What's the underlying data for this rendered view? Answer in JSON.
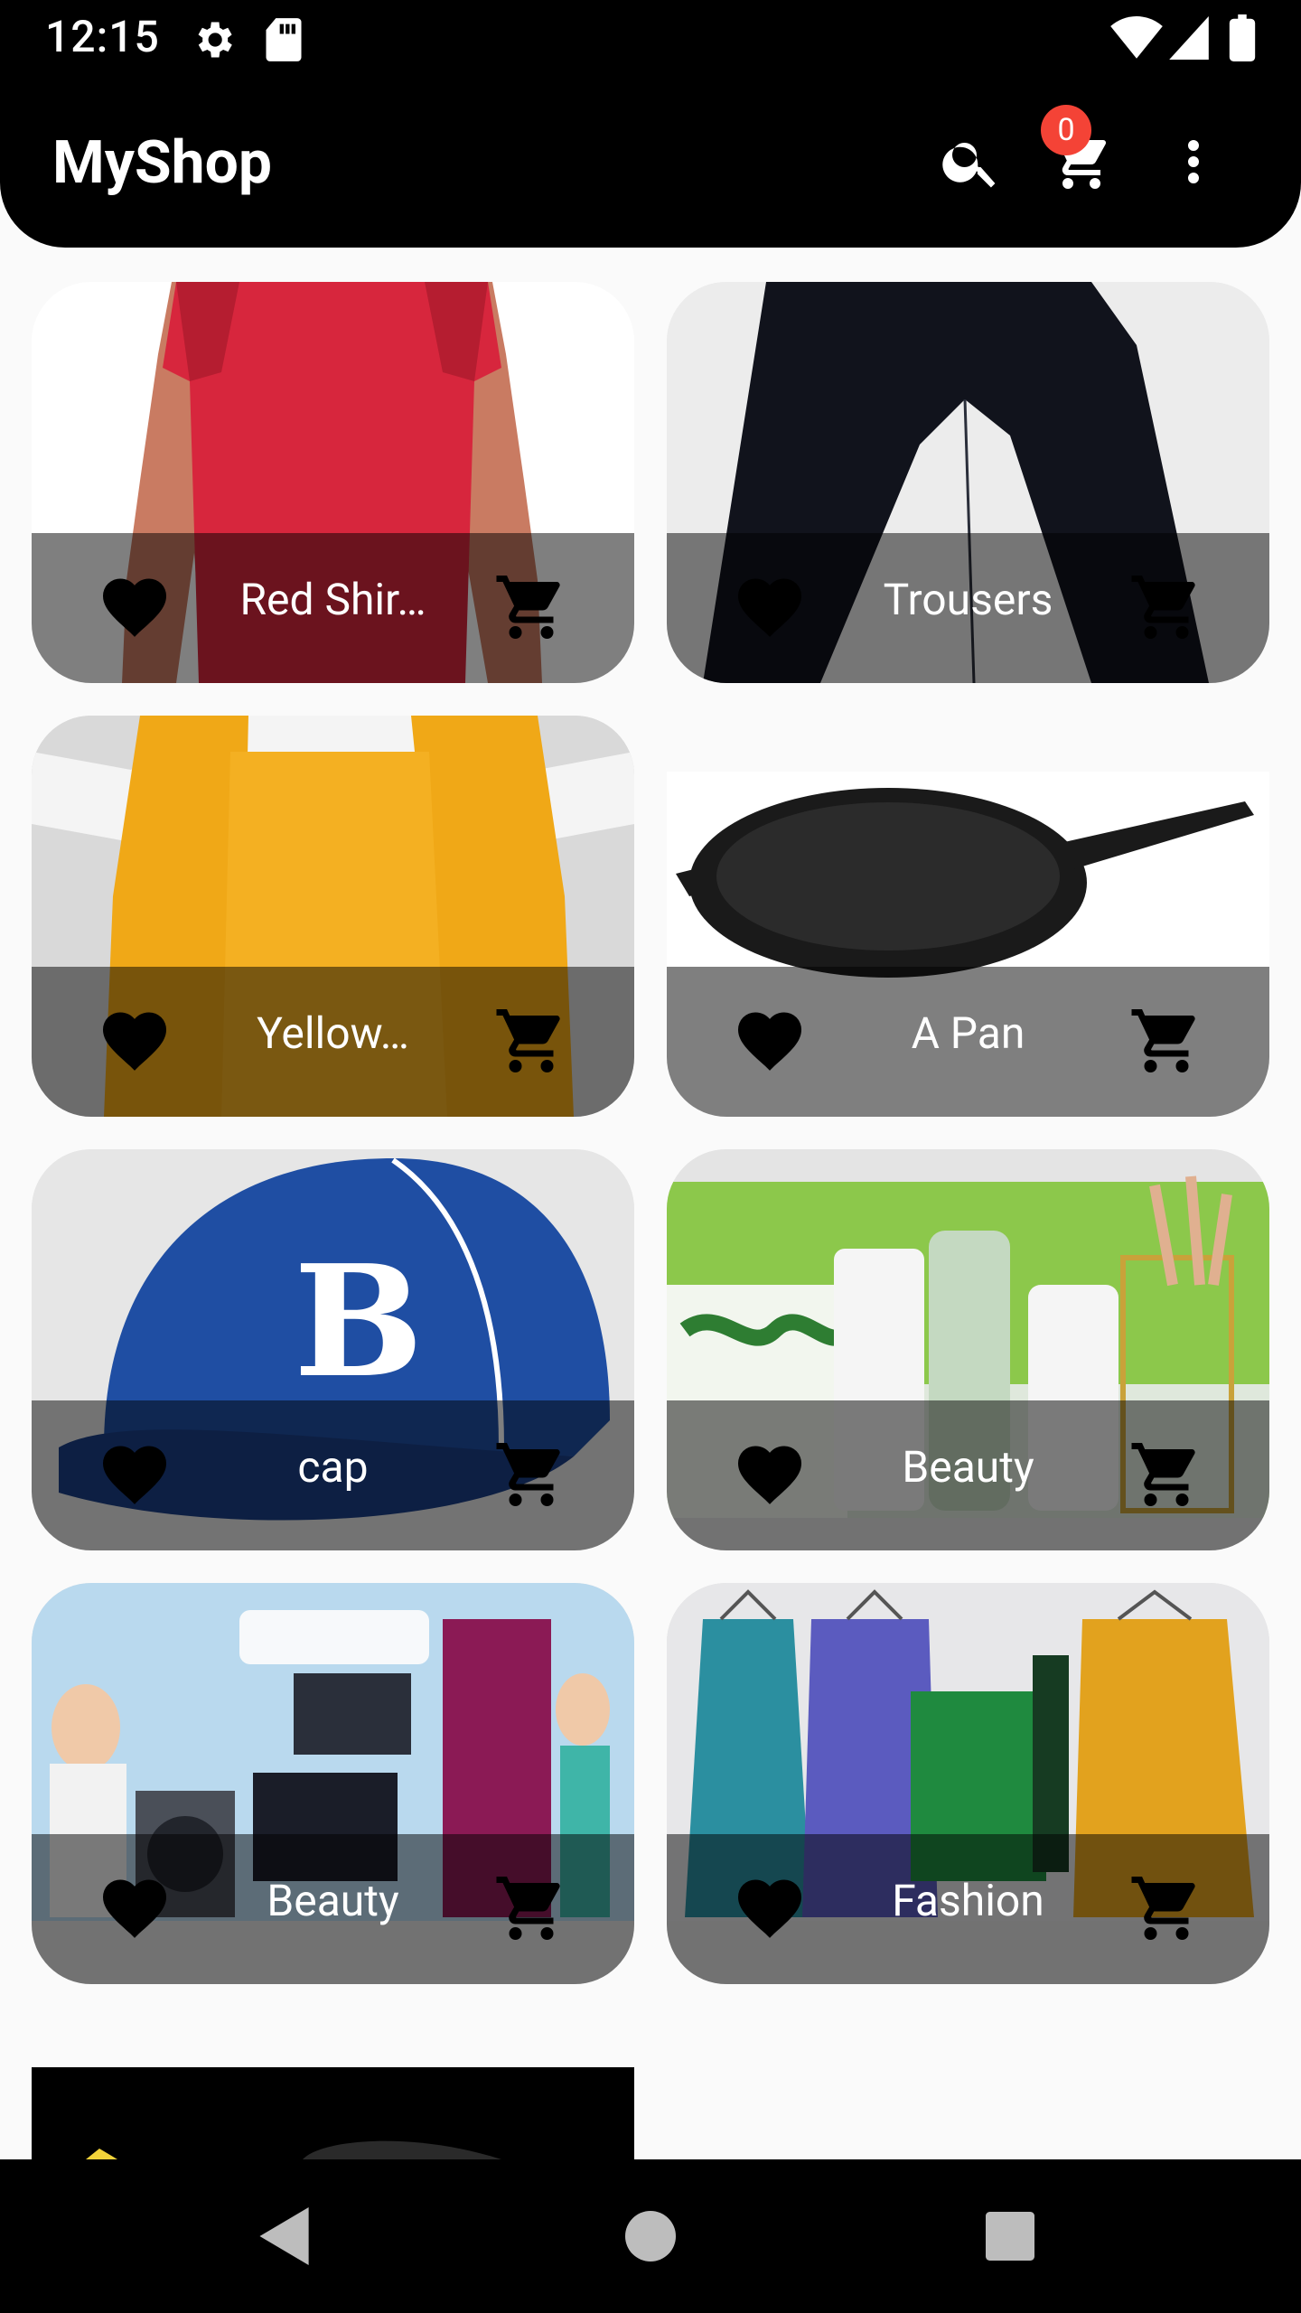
{
  "status_bar": {
    "time": "12:15",
    "icons": [
      "settings-icon",
      "sd-card-icon",
      "wifi-icon",
      "signal-icon",
      "battery-icon"
    ]
  },
  "app_bar": {
    "title": "MyShop",
    "cart_count": "0",
    "icons": [
      "search-icon",
      "cart-icon",
      "more-vert-icon"
    ]
  },
  "colors": {
    "app_bar": "#000000",
    "badge": "#f44336",
    "background": "#fafafa",
    "overlay": "rgba(0,0,0,0.5)"
  },
  "products": [
    {
      "title": "Red Shir…",
      "image": "red t-shirt on person"
    },
    {
      "title": "Trousers",
      "image": "black trousers"
    },
    {
      "title": "Yellow…",
      "image": "yellow knitted scarf"
    },
    {
      "title": "A Pan",
      "image": "black cast iron pan"
    },
    {
      "title": "cap",
      "image": "blue baseball cap"
    },
    {
      "title": "Beauty",
      "image": "skincare products"
    },
    {
      "title": "Beauty",
      "image": "home appliances"
    },
    {
      "title": "Fashion",
      "image": "jackets and dresses on hangers"
    }
  ],
  "nav_bar": {
    "icons": [
      "back-icon",
      "home-icon",
      "recents-icon"
    ]
  }
}
